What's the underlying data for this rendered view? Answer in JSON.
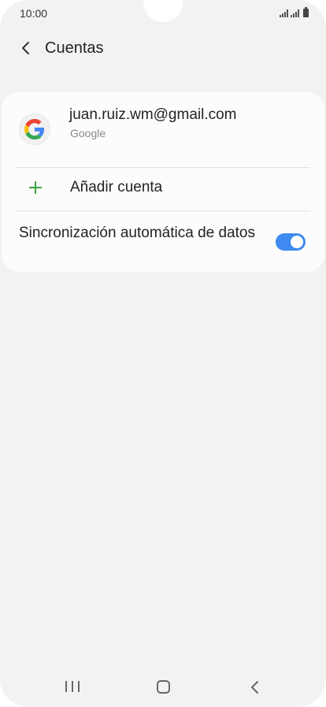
{
  "status_bar": {
    "time": "10:00"
  },
  "header": {
    "title": "Cuentas"
  },
  "account": {
    "email": "juan.ruiz.wm@gmail.com",
    "provider": "Google"
  },
  "add_account": {
    "label": "Añadir cuenta"
  },
  "sync": {
    "label": "Sincronización automática de datos",
    "enabled": true
  },
  "colors": {
    "accent": "#3e8af0",
    "add_icon": "#3fa33f",
    "background": "#f2f2f2",
    "card": "#fcfcfc"
  },
  "icons": {
    "back": "chevron-left-icon",
    "google": "google-logo-icon",
    "add": "plus-icon",
    "nav_recent": "recent-apps-icon",
    "nav_home": "home-icon",
    "nav_back": "back-icon"
  }
}
